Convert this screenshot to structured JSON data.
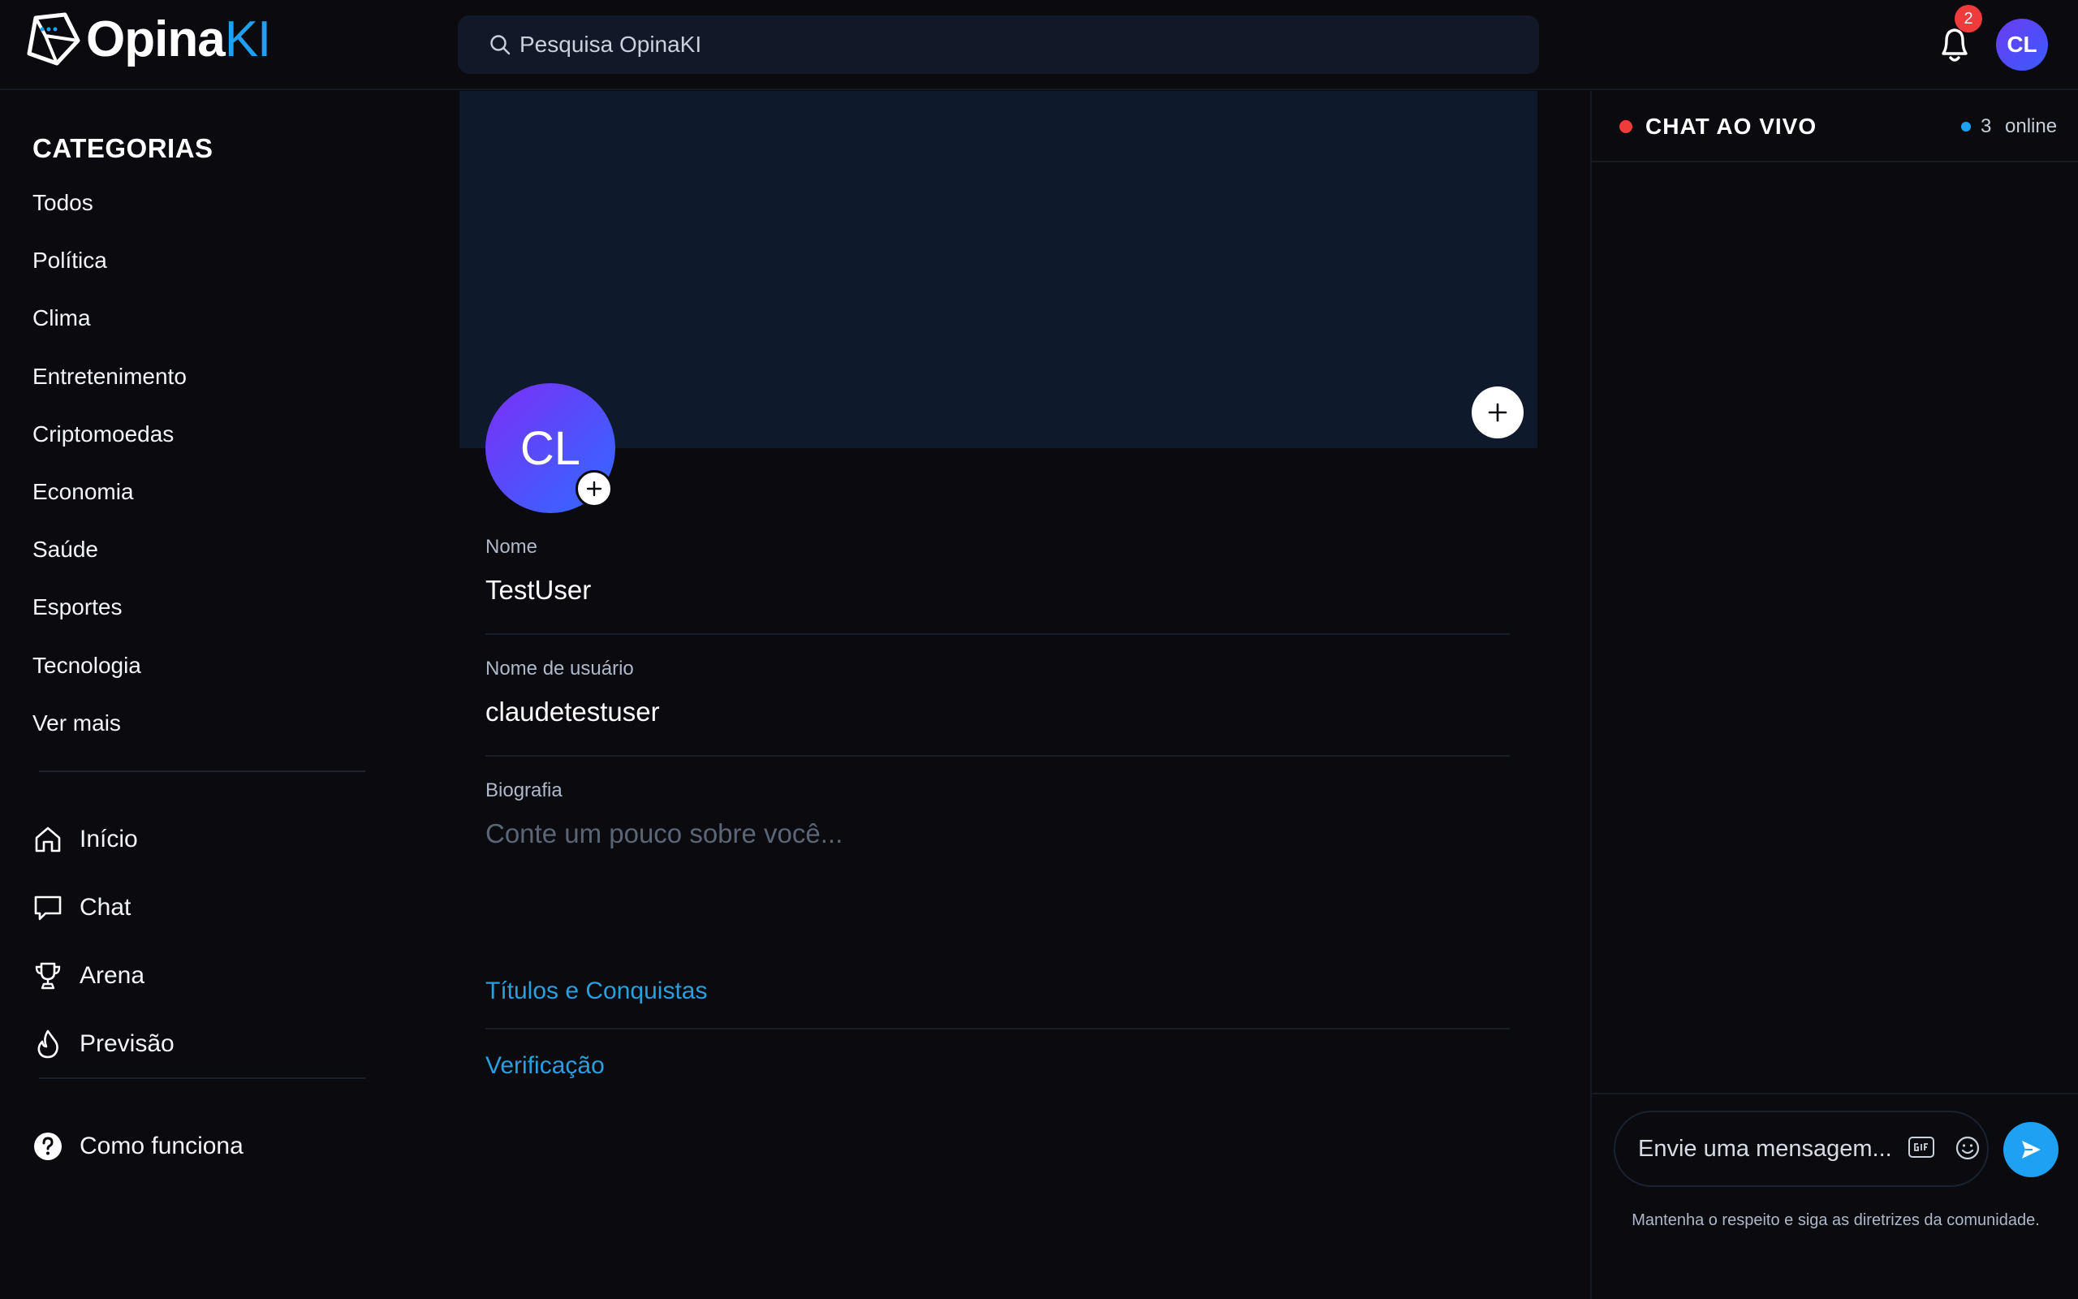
{
  "header": {
    "logo_primary": "Opina",
    "logo_accent": "KI",
    "search_placeholder": "Pesquisa OpinaKI",
    "notification_count": "2",
    "user_initials": "CL"
  },
  "sidebar": {
    "categories_title": "CATEGORIAS",
    "categories": [
      "Todos",
      "Política",
      "Clima",
      "Entretenimento",
      "Criptomoedas",
      "Economia",
      "Saúde",
      "Esportes",
      "Tecnologia",
      "Ver mais"
    ],
    "nav": [
      {
        "label": "Início",
        "icon": "home-icon"
      },
      {
        "label": "Chat",
        "icon": "chat-bubble-icon"
      },
      {
        "label": "Arena",
        "icon": "trophy-icon"
      },
      {
        "label": "Previsão",
        "icon": "flame-icon"
      }
    ],
    "help": {
      "label": "Como funciona",
      "icon": "question-circle-icon"
    }
  },
  "profile": {
    "avatar_initials": "CL",
    "name_label": "Nome",
    "name_value": "TestUser",
    "username_label": "Nome de usuário",
    "username_value": "claudetestuser",
    "bio_label": "Biografia",
    "bio_placeholder": "Conte um pouco sobre você...",
    "titles_link": "Títulos e Conquistas",
    "verification_link": "Verificação"
  },
  "chat": {
    "title": "CHAT AO VIVO",
    "online_count": "3",
    "online_label": "online",
    "input_placeholder": "Envie uma mensagem...",
    "rules": "Mantenha o respeito e siga as diretrizes da comunidade."
  },
  "colors": {
    "background": "#0a0a0f",
    "accent": "#1ea1f2",
    "banner": "#0e1a2b",
    "live": "#ef3b3b"
  }
}
